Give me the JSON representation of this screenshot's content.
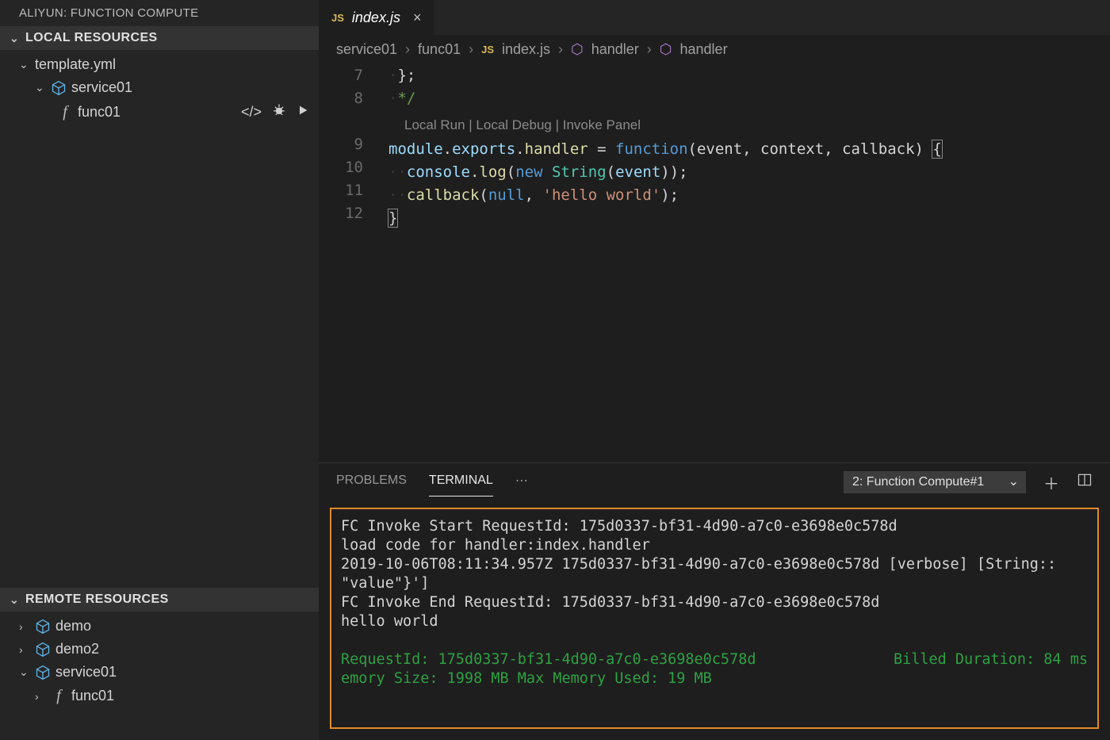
{
  "sidebar": {
    "title": "ALIYUN: FUNCTION COMPUTE",
    "local_header": "LOCAL RESOURCES",
    "template_file": "template.yml",
    "service": "service01",
    "function": "func01",
    "remote_header": "REMOTE RESOURCES",
    "remote": {
      "demo": "demo",
      "demo2": "demo2",
      "service01": "service01",
      "func01": "func01"
    }
  },
  "tab": {
    "badge": "JS",
    "filename": "index.js"
  },
  "breadcrumb": {
    "service": "service01",
    "func": "func01",
    "badge": "JS",
    "file": "index.js",
    "sym1": "handler",
    "sym2": "handler"
  },
  "code": {
    "line7": "};",
    "line8": "*/",
    "codelens": "Local Run | Local Debug | Invoke Panel",
    "line9": {
      "module": "module",
      "exports": "exports",
      "handler": "handler",
      "eq": " = ",
      "function": "function",
      "params": "(event, context, callback) "
    },
    "line10": {
      "console": "console",
      "log": "log",
      "new": "new",
      "String": "String",
      "event": "event"
    },
    "line11": {
      "callback": "callback",
      "null": "null",
      "str": "'hello world'"
    },
    "gutter": {
      "n7": "7",
      "n8": "8",
      "n9": "9",
      "n10": "10",
      "n11": "11",
      "n12": "12"
    }
  },
  "panel": {
    "problems": "PROBLEMS",
    "terminal": "TERMINAL",
    "dropdown": "2: Function Compute#1"
  },
  "terminal": {
    "l1": "FC Invoke Start RequestId: 175d0337-bf31-4d90-a7c0-e3698e0c578d",
    "l2": "load code for handler:index.handler",
    "l3": "2019-10-06T08:11:34.957Z 175d0337-bf31-4d90-a7c0-e3698e0c578d [verbose] [String:: \"value\"}']",
    "l4": "FC Invoke End RequestId: 175d0337-bf31-4d90-a7c0-e3698e0c578d",
    "l5": "hello world",
    "l6a": "RequestId: 175d0337-bf31-4d90-a7c0-e3698e0c578d",
    "l6b": "Billed Duration: 84 ms",
    "l7": "emory Size: 1998 MB    Max Memory Used: 19 MB"
  }
}
